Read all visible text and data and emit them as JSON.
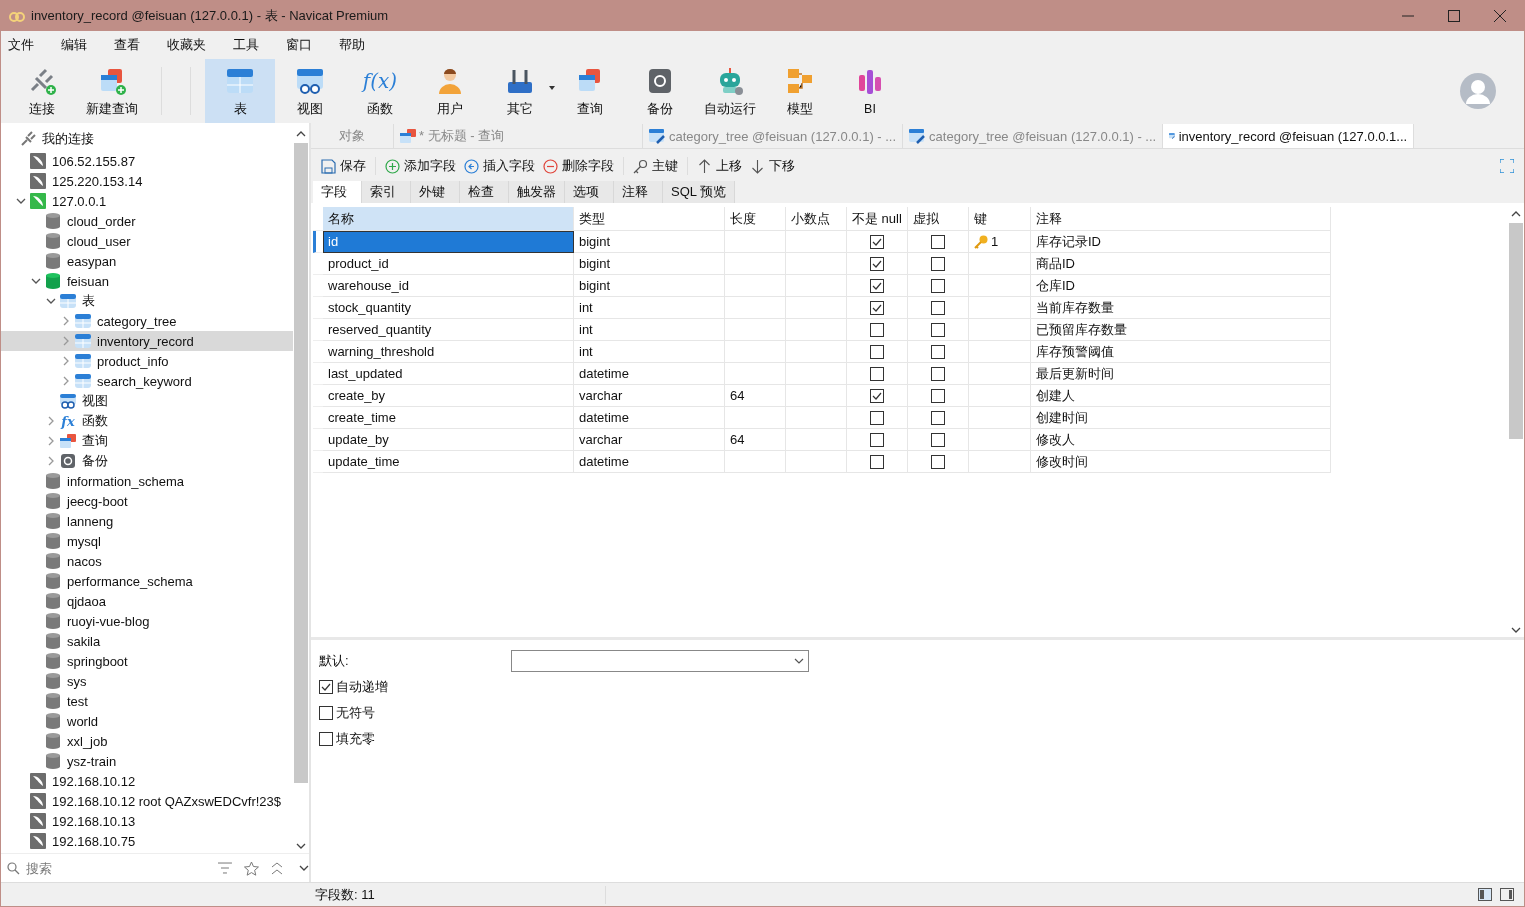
{
  "window": {
    "title": "inventory_record @feisuan (127.0.0.1) - 表 - Navicat Premium"
  },
  "menu": [
    "文件",
    "编辑",
    "查看",
    "收藏夹",
    "工具",
    "窗口",
    "帮助"
  ],
  "toolbar": [
    {
      "label": "连接",
      "kind": "connect",
      "selected": false
    },
    {
      "label": "新建查询",
      "kind": "new-query",
      "selected": false
    },
    {
      "label": "表",
      "kind": "table",
      "selected": true
    },
    {
      "label": "视图",
      "kind": "view",
      "selected": false
    },
    {
      "label": "函数",
      "kind": "function",
      "glyph": "f(x)",
      "selected": false
    },
    {
      "label": "用户",
      "kind": "user",
      "selected": false
    },
    {
      "label": "其它",
      "kind": "other",
      "selected": false
    },
    {
      "label": "查询",
      "kind": "query",
      "selected": false
    },
    {
      "label": "备份",
      "kind": "backup",
      "selected": false
    },
    {
      "label": "自动运行",
      "kind": "robot",
      "selected": false
    },
    {
      "label": "模型",
      "kind": "model",
      "selected": false
    },
    {
      "label": "BI",
      "kind": "bi",
      "selected": false
    }
  ],
  "tree": {
    "label": "我的连接",
    "kind": "root",
    "selected": false,
    "children": [
      {
        "label": "106.52.155.87",
        "kind": "connection",
        "open": false,
        "selected": false
      },
      {
        "label": "125.220.153.14",
        "kind": "connection",
        "open": false,
        "selected": false
      },
      {
        "label": "127.0.0.1",
        "kind": "connection",
        "open": true,
        "expanded": true,
        "selected": false,
        "children": [
          {
            "label": "cloud_order",
            "kind": "database",
            "open": false,
            "selected": false
          },
          {
            "label": "cloud_user",
            "kind": "database",
            "open": false,
            "selected": false
          },
          {
            "label": "easypan",
            "kind": "database",
            "open": false,
            "selected": false
          },
          {
            "label": "feisuan",
            "kind": "database",
            "open": true,
            "expanded": true,
            "selected": false,
            "children": [
              {
                "label": "表",
                "kind": "tables",
                "expanded": true,
                "selected": false,
                "children": [
                  {
                    "label": "category_tree",
                    "kind": "table",
                    "expanded": false,
                    "selected": false
                  },
                  {
                    "label": "inventory_record",
                    "kind": "table",
                    "expanded": false,
                    "selected": true
                  },
                  {
                    "label": "product_info",
                    "kind": "table",
                    "expanded": false,
                    "selected": false
                  },
                  {
                    "label": "search_keyword",
                    "kind": "table",
                    "expanded": false,
                    "selected": false
                  }
                ]
              },
              {
                "label": "视图",
                "kind": "views",
                "selected": false
              },
              {
                "label": "函数",
                "kind": "functions",
                "glyph": "fx",
                "expanded": false,
                "selected": false
              },
              {
                "label": "查询",
                "kind": "queries",
                "expanded": false,
                "selected": false
              },
              {
                "label": "备份",
                "kind": "backups",
                "expanded": false,
                "selected": false
              }
            ]
          },
          {
            "label": "information_schema",
            "kind": "database",
            "open": false,
            "selected": false
          },
          {
            "label": "jeecg-boot",
            "kind": "database",
            "open": false,
            "selected": false
          },
          {
            "label": "lanneng",
            "kind": "database",
            "open": false,
            "selected": false
          },
          {
            "label": "mysql",
            "kind": "database",
            "open": false,
            "selected": false
          },
          {
            "label": "nacos",
            "kind": "database",
            "open": false,
            "selected": false
          },
          {
            "label": "performance_schema",
            "kind": "database",
            "open": false,
            "selected": false
          },
          {
            "label": "qjdaoa",
            "kind": "database",
            "open": false,
            "selected": false
          },
          {
            "label": "ruoyi-vue-blog",
            "kind": "database",
            "open": false,
            "selected": false
          },
          {
            "label": "sakila",
            "kind": "database",
            "open": false,
            "selected": false
          },
          {
            "label": "springboot",
            "kind": "database",
            "open": false,
            "selected": false
          },
          {
            "label": "sys",
            "kind": "database",
            "open": false,
            "selected": false
          },
          {
            "label": "test",
            "kind": "database",
            "open": false,
            "selected": false
          },
          {
            "label": "world",
            "kind": "database",
            "open": false,
            "selected": false
          },
          {
            "label": "xxl_job",
            "kind": "database",
            "open": false,
            "selected": false
          },
          {
            "label": "ysz-train",
            "kind": "database",
            "open": false,
            "selected": false
          }
        ]
      },
      {
        "label": "192.168.10.12",
        "kind": "connection",
        "open": false,
        "selected": false
      },
      {
        "label": "192.168.10.12 root QAZxswEDCvfr!23$",
        "kind": "connection",
        "open": false,
        "selected": false
      },
      {
        "label": "192.168.10.13",
        "kind": "connection",
        "open": false,
        "selected": false
      },
      {
        "label": "192.168.10.75",
        "kind": "connection",
        "open": false,
        "selected": false
      }
    ]
  },
  "sidebar_search": {
    "placeholder": "搜索"
  },
  "doc_tabs": [
    {
      "label": "对象",
      "kind": "objects",
      "selected": false
    },
    {
      "label": "* 无标题 - 查询",
      "kind": "query",
      "selected": false
    },
    {
      "label": "category_tree @feisuan (127.0.0.1) - ...",
      "kind": "table",
      "selected": false
    },
    {
      "label": "category_tree @feisuan (127.0.0.1) - ...",
      "kind": "table",
      "selected": false
    },
    {
      "label": "inventory_record @feisuan (127.0.0.1...",
      "kind": "table",
      "selected": true
    }
  ],
  "actions": [
    {
      "label": "保存",
      "kind": "save"
    },
    {
      "kind": "separator"
    },
    {
      "label": "添加字段",
      "kind": "add"
    },
    {
      "label": "插入字段",
      "kind": "insert"
    },
    {
      "label": "删除字段",
      "kind": "delete"
    },
    {
      "kind": "separator"
    },
    {
      "label": "主键",
      "kind": "key"
    },
    {
      "kind": "separator"
    },
    {
      "label": "上移",
      "kind": "up"
    },
    {
      "label": "下移",
      "kind": "down"
    }
  ],
  "sub_tabs": [
    {
      "label": "字段",
      "selected": true
    },
    {
      "label": "索引",
      "selected": false
    },
    {
      "label": "外键",
      "selected": false
    },
    {
      "label": "检查",
      "selected": false
    },
    {
      "label": "触发器",
      "selected": false
    },
    {
      "label": "选项",
      "selected": false
    },
    {
      "label": "注释",
      "selected": false
    },
    {
      "label": "SQL 预览",
      "selected": false
    }
  ],
  "columns": [
    "名称",
    "类型",
    "长度",
    "小数点",
    "不是 null",
    "虚拟",
    "键",
    "注释"
  ],
  "fields": [
    {
      "name": "id",
      "type": "bigint",
      "not_null": true,
      "virtual": false,
      "key": "1",
      "comment": "库存记录ID",
      "selected": true
    },
    {
      "name": "product_id",
      "type": "bigint",
      "not_null": true,
      "virtual": false,
      "comment": "商品ID",
      "selected": false
    },
    {
      "name": "warehouse_id",
      "type": "bigint",
      "not_null": true,
      "virtual": false,
      "comment": "仓库ID",
      "selected": false
    },
    {
      "name": "stock_quantity",
      "type": "int",
      "not_null": true,
      "virtual": false,
      "comment": "当前库存数量",
      "selected": false
    },
    {
      "name": "reserved_quantity",
      "type": "int",
      "not_null": false,
      "virtual": false,
      "comment": "已预留库存数量",
      "selected": false
    },
    {
      "name": "warning_threshold",
      "type": "int",
      "not_null": false,
      "virtual": false,
      "comment": "库存预警阈值",
      "selected": false
    },
    {
      "name": "last_updated",
      "type": "datetime",
      "not_null": false,
      "virtual": false,
      "comment": "最后更新时间",
      "selected": false
    },
    {
      "name": "create_by",
      "type": "varchar",
      "length": "64",
      "not_null": true,
      "virtual": false,
      "comment": "创建人",
      "selected": false
    },
    {
      "name": "create_time",
      "type": "datetime",
      "not_null": false,
      "virtual": false,
      "comment": "创建时间",
      "selected": false
    },
    {
      "name": "update_by",
      "type": "varchar",
      "length": "64",
      "not_null": false,
      "virtual": false,
      "comment": "修改人",
      "selected": false
    },
    {
      "name": "update_time",
      "type": "datetime",
      "not_null": false,
      "virtual": false,
      "comment": "修改时间",
      "selected": false
    }
  ],
  "properties": {
    "default_label": "默认:",
    "options": [
      {
        "label": "自动递增",
        "checked": true
      },
      {
        "label": "无符号",
        "checked": false
      },
      {
        "label": "填充零",
        "checked": false
      }
    ]
  },
  "status_bar": {
    "text": "字段数: 11"
  }
}
